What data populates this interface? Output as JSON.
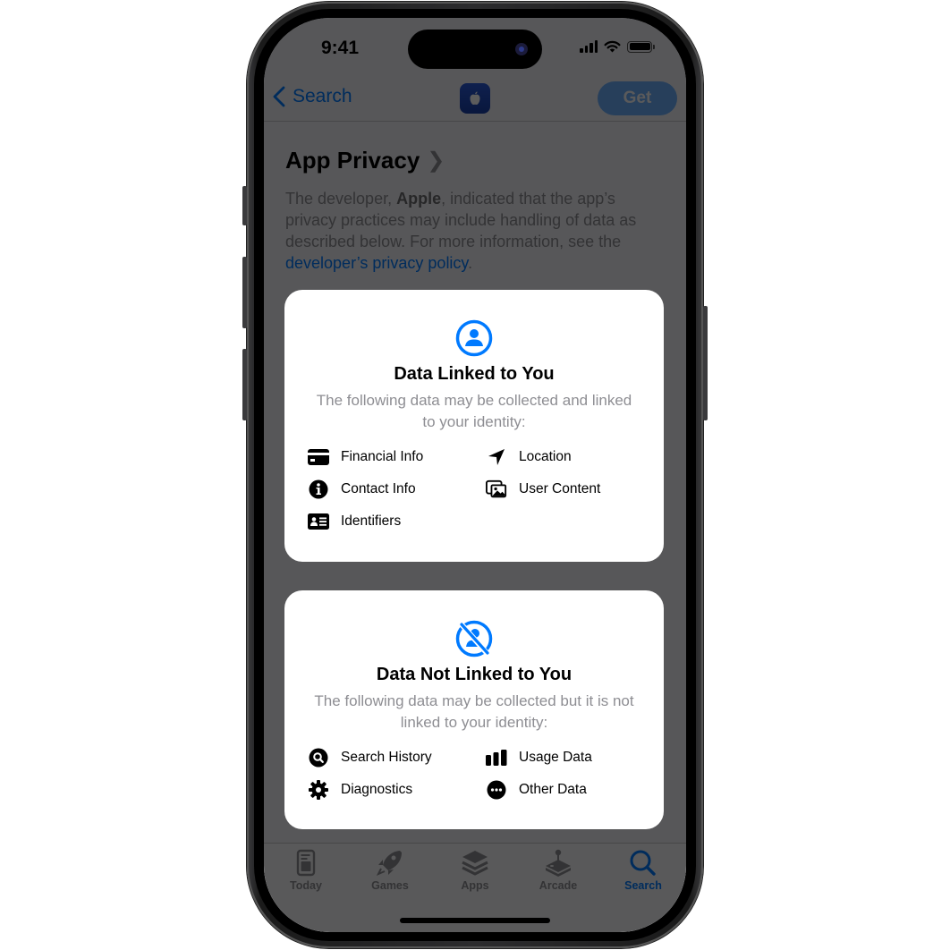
{
  "status_bar": {
    "time": "9:41"
  },
  "nav": {
    "back_label": "Search",
    "app_icon": "apple-logo-icon",
    "get_label": "Get"
  },
  "privacy": {
    "title": "App Privacy",
    "intro_prefix": "The developer, ",
    "developer": "Apple",
    "intro_middle": ", indicated that the app’s privacy practices may include handling of data as described below. For more information, see the ",
    "policy_link": "developer’s privacy policy",
    "intro_suffix": "."
  },
  "cards": [
    {
      "icon": "person-circle-icon",
      "title": "Data Linked to You",
      "subtitle": "The following data may be collected and linked to your identity:",
      "items": [
        {
          "label": "Financial Info",
          "icon": "credit-card-icon"
        },
        {
          "label": "Location",
          "icon": "location-arrow-icon"
        },
        {
          "label": "Contact Info",
          "icon": "info-circle-icon"
        },
        {
          "label": "User Content",
          "icon": "photos-icon"
        },
        {
          "label": "Identifiers",
          "icon": "id-card-icon"
        }
      ]
    },
    {
      "icon": "person-slash-icon",
      "title": "Data Not Linked to You",
      "subtitle": "The following data may be collected but it is not linked to your identity:",
      "items": [
        {
          "label": "Search History",
          "icon": "search-circle-icon"
        },
        {
          "label": "Usage Data",
          "icon": "bar-chart-icon"
        },
        {
          "label": "Diagnostics",
          "icon": "gear-icon"
        },
        {
          "label": "Other Data",
          "icon": "ellipsis-circle-icon"
        }
      ]
    }
  ],
  "tab_bar": {
    "tabs": [
      {
        "label": "Today",
        "icon": "today-icon",
        "active": false
      },
      {
        "label": "Games",
        "icon": "rocket-icon",
        "active": false
      },
      {
        "label": "Apps",
        "icon": "stack-icon",
        "active": false
      },
      {
        "label": "Arcade",
        "icon": "joystick-icon",
        "active": false
      },
      {
        "label": "Search",
        "icon": "search-icon",
        "active": true
      }
    ]
  },
  "colors": {
    "accent": "#007aff",
    "overlay": "rgba(0,0,0,0.64)",
    "card_bg": "#ffffff"
  }
}
